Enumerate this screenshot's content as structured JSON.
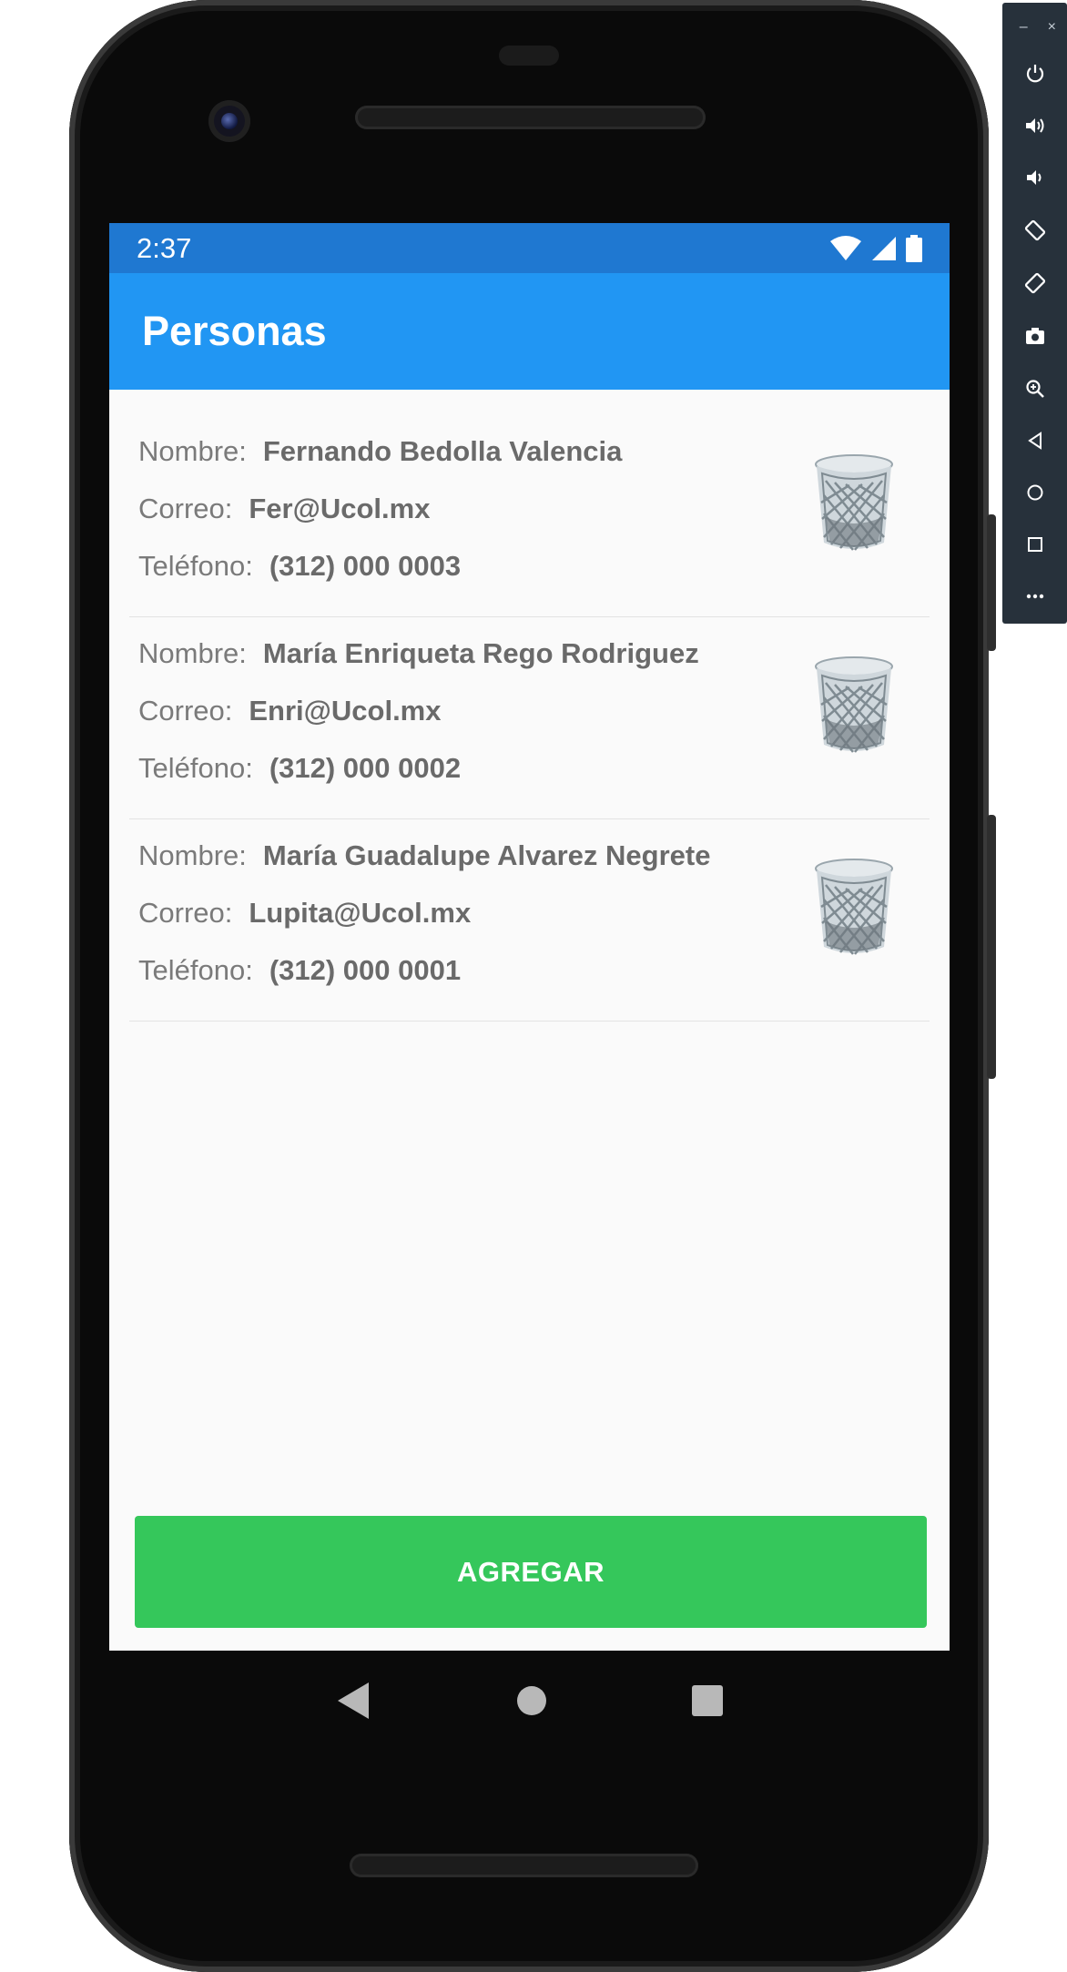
{
  "status": {
    "time": "2:37"
  },
  "appbar": {
    "title": "Personas"
  },
  "labels": {
    "name": "Nombre:",
    "email": "Correo:",
    "phone": "Teléfono:"
  },
  "people": [
    {
      "name": "Fernando Bedolla Valencia",
      "email": "Fer@Ucol.mx",
      "phone": "(312) 000 0003"
    },
    {
      "name": "María Enriqueta Rego Rodriguez",
      "email": "Enri@Ucol.mx",
      "phone": "(312) 000 0002"
    },
    {
      "name": "María Guadalupe Alvarez Negrete",
      "email": "Lupita@Ucol.mx",
      "phone": "(312) 000 0001"
    }
  ],
  "actions": {
    "add_label": "AGREGAR"
  },
  "colors": {
    "status_bar": "#1f78d1",
    "app_bar": "#2196f3",
    "add_button": "#35c75b",
    "background": "#fafafa"
  },
  "icons": {
    "delete": "trash-icon",
    "status": [
      "wifi-icon",
      "signal-icon",
      "battery-icon"
    ],
    "nav": [
      "back-icon",
      "home-icon",
      "recents-icon"
    ],
    "emulator_toolbar": [
      "minimize-icon",
      "close-icon",
      "power-icon",
      "volume-up-icon",
      "volume-down-icon",
      "rotate-left-icon",
      "rotate-right-icon",
      "camera-icon",
      "zoom-icon",
      "back-icon",
      "home-icon",
      "overview-icon",
      "more-icon"
    ]
  }
}
